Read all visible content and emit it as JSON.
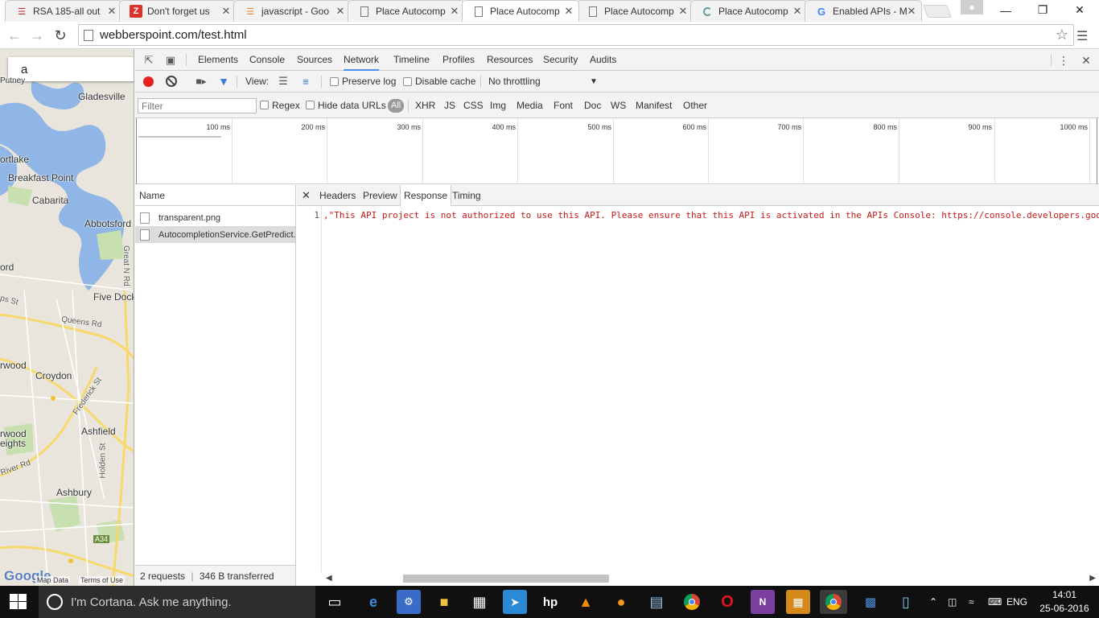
{
  "browser": {
    "tabs": [
      {
        "title": "RSA 185-all out",
        "icon": "red-lines-icon",
        "active": false
      },
      {
        "title": "Don't forget us",
        "icon": "red-z-icon",
        "active": false
      },
      {
        "title": "javascript - Goo",
        "icon": "stackoverflow-icon",
        "active": false
      },
      {
        "title": "Place Autocomp",
        "icon": "page-icon",
        "active": false
      },
      {
        "title": "Place Autocomp",
        "icon": "page-icon",
        "active": true
      },
      {
        "title": "Place Autocomp",
        "icon": "page-icon",
        "active": false
      },
      {
        "title": "Place Autocomp",
        "icon": "loading-icon",
        "active": false
      },
      {
        "title": "Enabled APIs - M",
        "icon": "google-icon",
        "active": false
      }
    ],
    "url": "webberspoint.com/test.html"
  },
  "map": {
    "search_value": "a",
    "labels": [
      "Putney",
      "Gladesville",
      "ortlake",
      "Breakfast Point",
      "Cabarita",
      "Abbotsford",
      "ord",
      "Great N Rd",
      "Five Dock",
      "ps St",
      "Queens Rd",
      "rwood",
      "Croydon",
      "Frederick St",
      "Ashfield",
      "rwood",
      "eights",
      "Holden St",
      "River Rd",
      "Ashbury",
      "A34"
    ],
    "footer": {
      "map_data": "Map Data",
      "terms": "Terms of Use"
    },
    "logo_text": "Google"
  },
  "devtools": {
    "tabs": [
      "Elements",
      "Console",
      "Sources",
      "Network",
      "Timeline",
      "Profiles",
      "Resources",
      "Security",
      "Audits"
    ],
    "active_tab": "Network",
    "toolbar": {
      "view_label": "View:",
      "preserve_log": "Preserve log",
      "disable_cache": "Disable cache",
      "throttling": "No throttling"
    },
    "filter": {
      "placeholder": "Filter",
      "regex": "Regex",
      "hide_data_urls": "Hide data URLs",
      "types": [
        "All",
        "XHR",
        "JS",
        "CSS",
        "Img",
        "Media",
        "Font",
        "Doc",
        "WS",
        "Manifest",
        "Other"
      ]
    },
    "overview_ticks": [
      "100 ms",
      "200 ms",
      "300 ms",
      "400 ms",
      "500 ms",
      "600 ms",
      "700 ms",
      "800 ms",
      "900 ms",
      "1000 ms"
    ],
    "requests": {
      "header": "Name",
      "rows": [
        "transparent.png",
        "AutocompletionService.GetPredict..."
      ],
      "selected_index": 1
    },
    "detail_tabs": [
      "Headers",
      "Preview",
      "Response",
      "Timing"
    ],
    "active_detail_tab": "Response",
    "response": {
      "line_number": "1",
      "text": ",\"This API project is not authorized to use this API. Please ensure that this API is activated in the APIs Console: https://console.developers.google.com/apis/library?project=_\""
    },
    "status": {
      "requests": "2 requests",
      "separator": "|",
      "transferred": "346 B transferred"
    }
  },
  "taskbar": {
    "search_placeholder": "I'm Cortana. Ask me anything.",
    "language": "ENG",
    "time": "14:01",
    "date": "25-06-2016"
  },
  "colors": {
    "record_red": "#e42020",
    "error_text": "#c41a16",
    "active_tab_underline": "#4a8ff7",
    "map_water": "#8fb6e6",
    "taskbar": "#101010"
  }
}
